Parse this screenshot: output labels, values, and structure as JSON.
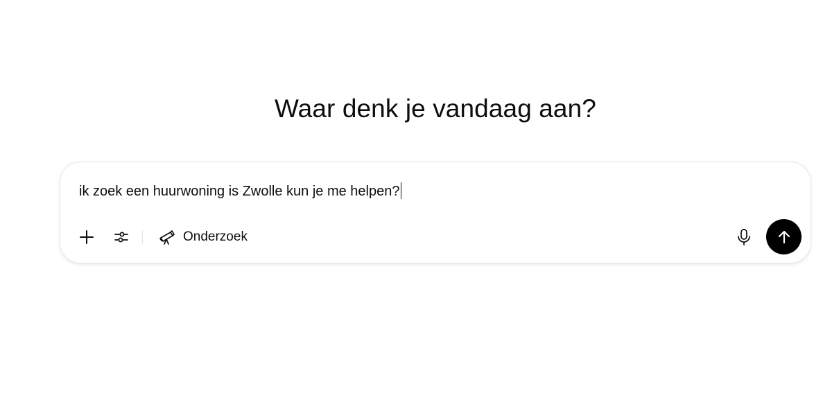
{
  "main": {
    "heading": "Waar denk je vandaag aan?"
  },
  "composer": {
    "input_value": "ik zoek een huurwoning is Zwolle kun je me helpen?",
    "toolbar": {
      "add_icon": "plus-icon",
      "tools_icon": "sliders-icon",
      "research_icon": "telescope-icon",
      "research_label": "Onderzoek"
    },
    "mic_icon": "microphone-icon",
    "send_icon": "arrow-up-icon",
    "send_button_color": "#000000"
  }
}
